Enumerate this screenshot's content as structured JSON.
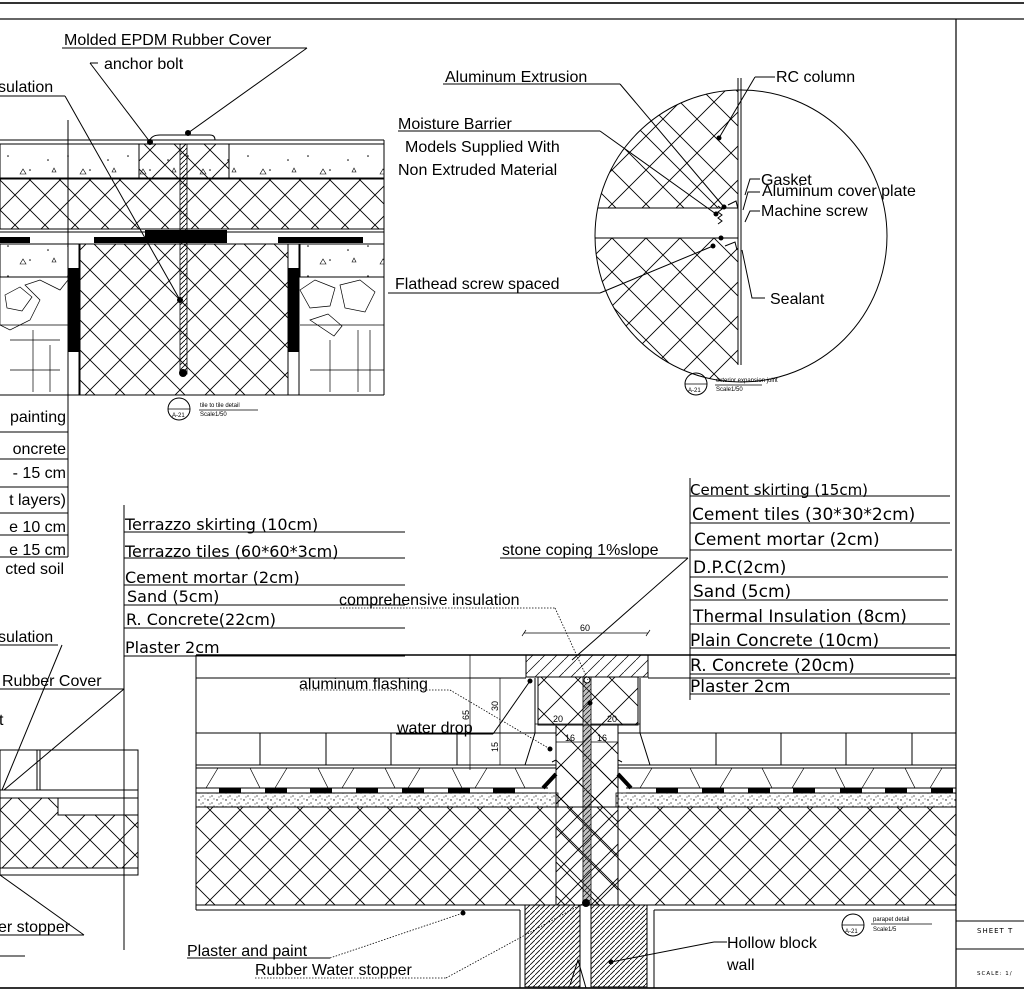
{
  "drawing": {
    "detail_tile_to_tile": {
      "labels": {
        "molded_cover": "Molded EPDM Rubber Cover",
        "anchor_bolt": "anchor bolt",
        "insulation_partial": "sulation"
      },
      "callout": {
        "number": "A-21",
        "title": "tile to tile detail",
        "scale": "Scale1/50"
      }
    },
    "detail_expansion_joint": {
      "labels": {
        "aluminum_extrusion": "Aluminum Extrusion",
        "rc_column": "RC column",
        "moisture_barrier": "Moisture Barrier",
        "models_line1": "Models Supplied With",
        "models_line2": "Non Extruded Material",
        "gasket": "Gasket",
        "aluminum_cover_plate": "Aluminum cover plate",
        "machine_screw": "Machine screw",
        "flathead_screw": "Flathead screw spaced",
        "sealant": "Sealant"
      },
      "callout": {
        "number": "A-21",
        "title": "exterior expansion joint",
        "scale": "Scale1/50"
      }
    },
    "left_layer_legend": [
      "painting",
      "oncrete",
      "- 15 cm",
      "t layers)",
      "e 10 cm",
      "e 15 cm",
      "cted soil"
    ],
    "lower_left_detail": {
      "labels": {
        "insulation_partial": "sulation",
        "rubber_cover_partial": "Rubber Cover",
        "bolt_partial": "t",
        "stopper_partial": "er stopper"
      }
    },
    "parapet_left_layers": [
      "Terrazzo skirting (10cm)",
      "Terrazzo tiles (60*60*3cm)",
      "Cement mortar (2cm)",
      "Sand (5cm)",
      "R. Concrete(22cm)",
      "Plaster 2cm"
    ],
    "parapet_right_layers": [
      "Cement skirting (15cm)",
      "Cement tiles (30*30*2cm)",
      "Cement mortar (2cm)",
      "D.P.C(2cm)",
      "Sand (5cm)",
      "Thermal Insulation (8cm)",
      "Plain Concrete (10cm)",
      "R. Concrete (20cm)",
      "Plaster 2cm"
    ],
    "parapet_labels": {
      "stone_coping": "stone coping 1%slope",
      "comprehensive_insulation": "comprehensive insulation",
      "aluminum_flashing": "aluminum flashing",
      "water_drop": "water drop",
      "plaster_paint": "Plaster and paint",
      "rubber_water_stopper": "Rubber Water stopper",
      "hollow_block_1": "Hollow block",
      "hollow_block_2": "wall"
    },
    "dimensions": {
      "coping_width": "60",
      "height_65": "65",
      "height_30": "30",
      "height_15": "15",
      "offset_20_left": "20",
      "offset_20_right": "20",
      "offset_16_left": "16",
      "offset_16_right": "16"
    },
    "parapet_callout": {
      "number": "A-21",
      "title": "parapet detail",
      "scale": "Scale1/5"
    }
  },
  "title_block": {
    "sheet_title_partial": "SHEET T",
    "scale_partial": "SCALE: 1/"
  }
}
